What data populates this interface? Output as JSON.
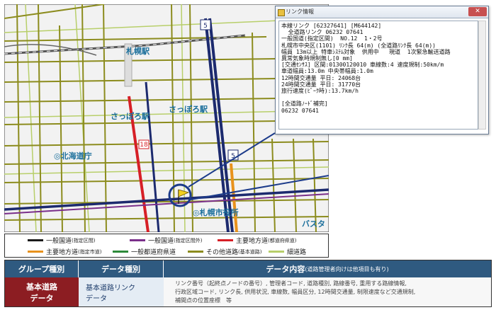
{
  "map": {
    "labels": {
      "sapporo_stn_small": "札幌駅",
      "sapporo_stn_hira": "さっぽろ駅",
      "sapporo_stn_hira2": "さっぽろ駅",
      "hokkaido_govt": "◎北海道庁",
      "city_hall": "◎札幌市役所",
      "bus_terminal": "バスタ",
      "route5_top": "5",
      "route5_mid": "5",
      "route18": "18"
    }
  },
  "legend": {
    "row1": [
      {
        "label": "一般国道",
        "sub": "(指定区間)",
        "color": "#1a1a1a"
      },
      {
        "label": "一般国道",
        "sub": "(指定区間外)",
        "color": "#7a2f8a"
      },
      {
        "label": "主要地方道",
        "sub": "(都道府県道)",
        "color": "#d61f26"
      }
    ],
    "row2": [
      {
        "label": "主要地方道",
        "sub": "(指定市道)",
        "color": "#e8921c"
      },
      {
        "label": "一般都道府県道",
        "sub": "",
        "color": "#2d8a3a"
      },
      {
        "label": "その他道路",
        "sub": "(基本道路)",
        "color": "#8c8c1e"
      },
      {
        "label": "細道路",
        "sub": "",
        "color": "#b8cf6a"
      }
    ]
  },
  "popup": {
    "title": "リンク情報",
    "close": "✕",
    "lines": [
      "本線リンク [62327641] [M644142]",
      "  全道路リンク 06232 07641",
      "一般国道(指定区間)  NO.12  1・2号",
      "札幌市中央区(1101) ﾘﾝｸ長 64(m) (全道路ﾘﾝｸ長 64(m))",
      "幅員 13m以上 特車ｼｽﾃﾑ対象  供用中   現道  1次緊急輸送道路",
      "異常気象時規制無し[0 mm]",
      "[交通ｾﾝｻｽ] 区間:01300120010 車線数:4 速度規制:50km/m",
      "車道幅員:13.0m 中央帯幅員:1.0m",
      "12時間交通量 平日: 24068台",
      "24時間交通量 平日: 31770台",
      "旅行速度(ﾋﾟｰｸ時):13.7km/h",
      "",
      "[全道路ﾉｰﾄﾞ補完]",
      "06232 07641"
    ]
  },
  "table": {
    "headers": {
      "group": "グループ種別",
      "data_type": "データ種別",
      "content": "データ内容",
      "content_note": "(道路管理者向けは他項目も有り)"
    },
    "row": {
      "group": "基本道路\nデータ",
      "data_type": "基本道路リンク\nデータ",
      "content": "リンク番号（起終点ノードの番号）, 管理者コード, 道路種別, 路線番号, 重用する路線情報,\n行政区域コード, リンク長, 供用状況, 車線数, 幅員区分, 12時間交通量, 制限速度など交通規制,\n補間点の位置座標　等"
    }
  }
}
